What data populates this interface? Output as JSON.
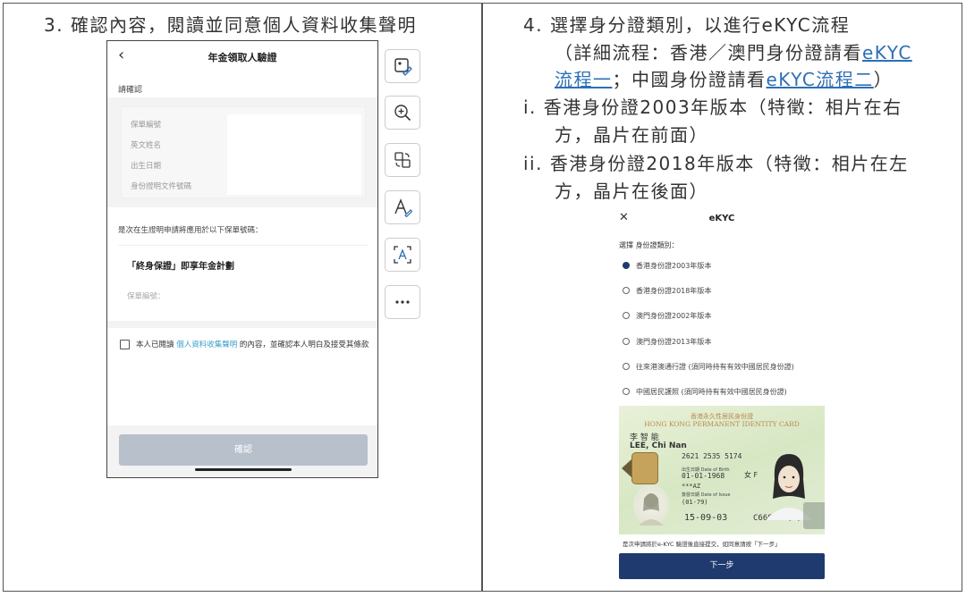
{
  "left": {
    "step_heading": "3. 確認內容，閱讀並同意個人資料收集聲明",
    "phone": {
      "back_glyph": "‹",
      "title": "年金領取人驗證",
      "confirm_label": "請確認",
      "fields": [
        "保單編號",
        "英文姓名",
        "出生日期",
        "身份證明文件號碼"
      ],
      "apply_text": "是次在生證明申請將應用於以下保單號碼：",
      "plan_name": "「終身保證」即享年金計劃",
      "policy_label": "保單編號：",
      "agree_pre": "本人已閱讀 ",
      "agree_link": "個人資料收集聲明",
      "agree_post": " 的內容，並確認本人明白及接受其條款",
      "confirm_button": "確認"
    },
    "tools": [
      "image-edit-icon",
      "zoom-in-icon",
      "image-convert-icon",
      "text-edit-icon",
      "ocr-icon",
      "more-icon"
    ]
  },
  "right": {
    "step4_line1": "4. 選擇身分證類別，以進行eKYC流程",
    "step4_line2_pre": "（詳細流程：香港／澳門身份證請看",
    "step4_link1_a": "eKYC",
    "step4_link1_b": "流程一",
    "step4_line3_mid": "；中國身份證請看",
    "step4_link2": "eKYC流程二",
    "step4_line3_post": "）",
    "item_i_a": "i.  香港身份證2003年版本（特徵：相片在右",
    "item_i_b": "方，晶片在前面）",
    "item_ii_a": "ii. 香港身份證2018年版本（特徵：相片在左",
    "item_ii_b": "方，晶片在後面）",
    "phone": {
      "close_glyph": "✕",
      "title": "eKYC",
      "select_label": "選擇 身份證類別：",
      "options": [
        {
          "label": "香港身份證2003年版本",
          "selected": true
        },
        {
          "label": "香港身份證2018年版本",
          "selected": false
        },
        {
          "label": "澳門身份證2002年版本",
          "selected": false
        },
        {
          "label": "澳門身份證2013年版本",
          "selected": false
        },
        {
          "label": "往來港澳通行證 (須同時持有有效中國居民身份證)",
          "selected": false
        },
        {
          "label": "中國居民護照 (須同時持有有效中國居民身份證)",
          "selected": false
        }
      ],
      "card": {
        "header_cn": "香港永久性居民身份證",
        "header_en": "HONG KONG PERMANENT IDENTITY CARD",
        "name_cn": "李 智 能",
        "name_en": "LEE, Chi Nan",
        "ccc": "2621 2535 5174",
        "dob_label": "出生日期 Date of Birth",
        "dob": "01-01-1968",
        "sex": "女 F",
        "symbols": "***AZ",
        "issue_label": "簽發日期 Date of Issue",
        "issue_first": "(01-79)",
        "issue_date": "15-09-03",
        "id_number": "C668668(E)"
      },
      "note": "是次申請將於e-KYC 驗證後直接提交，如同意請按「下一步」",
      "next_button": "下一步"
    }
  }
}
